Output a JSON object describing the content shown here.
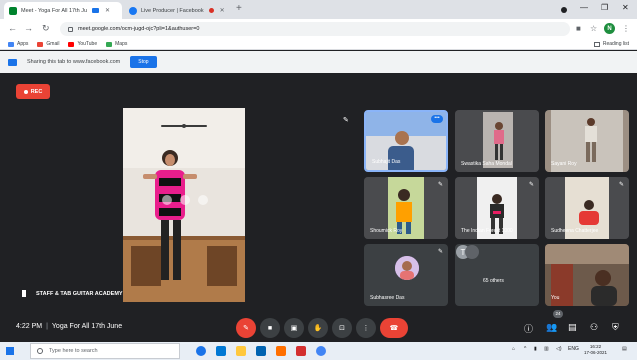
{
  "browser": {
    "tabs": [
      {
        "title": "Meet - Yoga For All 17th Ju",
        "active": true
      },
      {
        "title": "Live Producer | Facebook",
        "active": false
      }
    ],
    "url": "meet.google.com/ocm-jugd-ojc?pli=1&authuser=0",
    "profile_initial": "N",
    "bookmarks": [
      {
        "label": "Apps",
        "color": "#4285f4"
      },
      {
        "label": "Gmail",
        "color": "#ea4335"
      },
      {
        "label": "YouTube",
        "color": "#ff0000"
      },
      {
        "label": "Maps",
        "color": "#34a853"
      }
    ],
    "reading_list": "Reading list"
  },
  "share_bar": {
    "message": "Sharing this tab to www.facebook.com",
    "stop_label": "Stop"
  },
  "meet": {
    "rec_label": "REC",
    "presenter_name": "STAFF & TAB GUITAR ACADEMY",
    "time": "4:22 PM",
    "meeting_title": "Yoga For All 17th June",
    "people_count": "24",
    "participants": [
      {
        "name": "Subhajit Das",
        "selected": true
      },
      {
        "name": "Swastika Saha Mondal",
        "selected": false
      },
      {
        "name": "Sayani Roy",
        "selected": false
      },
      {
        "name": "Shoumick Roy",
        "selected": false
      },
      {
        "name": "The Indian Forest 1000",
        "selected": false
      },
      {
        "name": "Sudheena Chatterjee",
        "selected": false
      },
      {
        "name": "Subhasree Das",
        "selected": false
      },
      {
        "name": "65 others",
        "selected": false
      },
      {
        "name": "You",
        "selected": false
      }
    ]
  },
  "taskbar": {
    "search_placeholder": "Type here to search",
    "language": "ENG",
    "clock_time": "16:22",
    "clock_date": "17-06-2021"
  },
  "colors": {
    "meet_bg": "#202124",
    "tile_bg": "#3c4043",
    "accent_blue": "#1a73e8",
    "rec_red": "#ea4335"
  }
}
